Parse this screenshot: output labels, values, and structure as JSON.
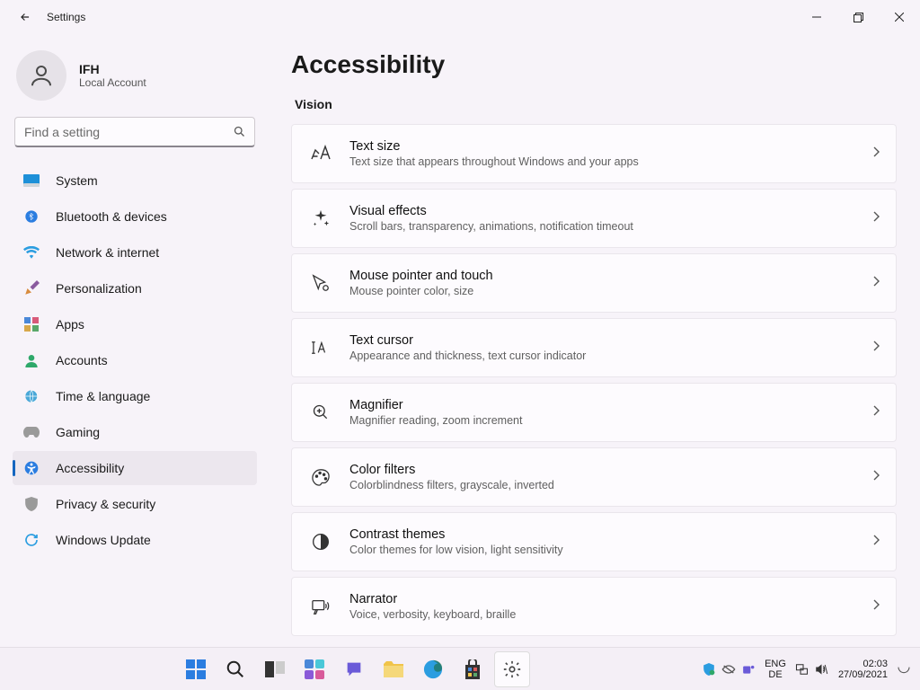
{
  "window": {
    "title": "Settings"
  },
  "account": {
    "name": "IFH",
    "type": "Local Account"
  },
  "search": {
    "placeholder": "Find a setting"
  },
  "nav": {
    "items": [
      {
        "label": "System"
      },
      {
        "label": "Bluetooth & devices"
      },
      {
        "label": "Network & internet"
      },
      {
        "label": "Personalization"
      },
      {
        "label": "Apps"
      },
      {
        "label": "Accounts"
      },
      {
        "label": "Time & language"
      },
      {
        "label": "Gaming"
      },
      {
        "label": "Accessibility"
      },
      {
        "label": "Privacy & security"
      },
      {
        "label": "Windows Update"
      }
    ]
  },
  "page": {
    "title": "Accessibility",
    "section": "Vision",
    "cards": [
      {
        "title": "Text size",
        "sub": "Text size that appears throughout Windows and your apps"
      },
      {
        "title": "Visual effects",
        "sub": "Scroll bars, transparency, animations, notification timeout"
      },
      {
        "title": "Mouse pointer and touch",
        "sub": "Mouse pointer color, size"
      },
      {
        "title": "Text cursor",
        "sub": "Appearance and thickness, text cursor indicator"
      },
      {
        "title": "Magnifier",
        "sub": "Magnifier reading, zoom increment"
      },
      {
        "title": "Color filters",
        "sub": "Colorblindness filters, grayscale, inverted"
      },
      {
        "title": "Contrast themes",
        "sub": "Color themes for low vision, light sensitivity"
      },
      {
        "title": "Narrator",
        "sub": "Voice, verbosity, keyboard, braille"
      }
    ]
  },
  "taskbar": {
    "lang1": "ENG",
    "lang2": "DE",
    "time": "02:03",
    "date": "27/09/2021"
  }
}
